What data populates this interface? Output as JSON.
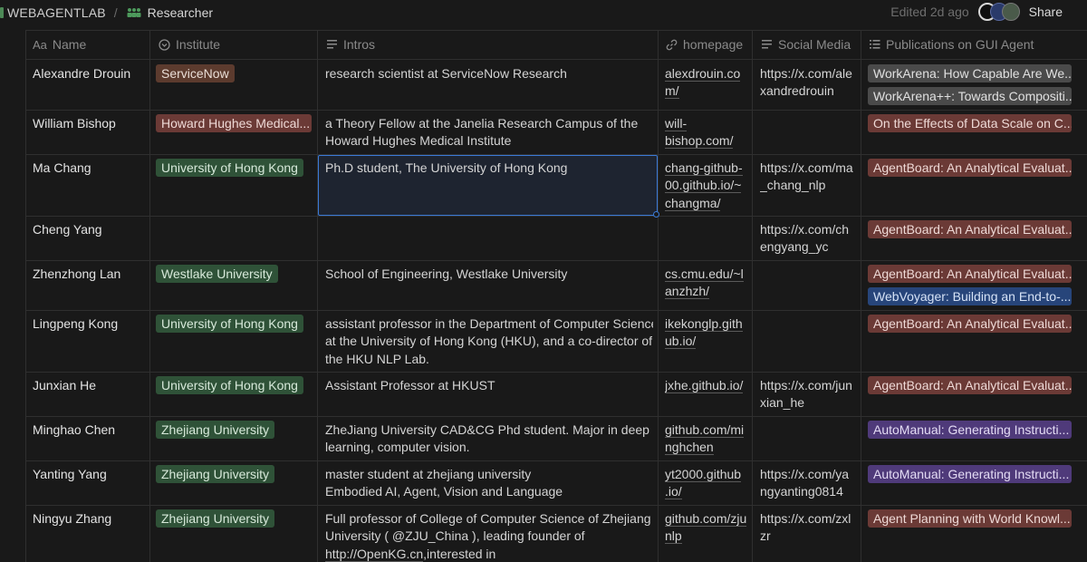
{
  "topbar": {
    "workspace": "WEBAGENTLAB",
    "separator": "/",
    "page_title": "Researcher",
    "edited": "Edited 2d ago",
    "share": "Share"
  },
  "columns": {
    "name": "Name",
    "name_icon": "Aa",
    "institute": "Institute",
    "intros": "Intros",
    "homepage": "homepage",
    "social": "Social Media",
    "publications": "Publications on GUI Agent"
  },
  "colors": {
    "brown": "#5c3b2e",
    "green": "#2f5238",
    "pink": "#6b3a36",
    "purple": "#4f3a7a",
    "blue": "#27457a",
    "gray": "#4a4a4a",
    "selection": "#3b7ad6"
  },
  "rows": [
    {
      "name": "Alexandre Drouin",
      "institute": "ServiceNow",
      "intro": [
        "research scientist at ServiceNow Research"
      ],
      "homepage": [
        "alexdrouin.co",
        "m/"
      ],
      "social": [
        "https://x.com/ale",
        "xandredrouin"
      ],
      "pubs": [
        "WorkArena: How Capable Are We...",
        "WorkArena++: Towards Compositi..."
      ]
    },
    {
      "name": "William Bishop",
      "institute": "Howard Hughes Medical...",
      "intro": [
        "a Theory Fellow at the Janelia Research Campus of the",
        "Howard Hughes Medical Institute"
      ],
      "homepage": [
        "will-",
        "bishop.com/"
      ],
      "social": [],
      "pubs": [
        "On the Effects of Data Scale on C..."
      ]
    },
    {
      "name": "Ma Chang",
      "institute": "University of Hong Kong",
      "intro": [
        "Ph.D student, The University of Hong Kong"
      ],
      "homepage": [
        "chang-github-",
        "00.github.io/~",
        "changma/"
      ],
      "social": [
        "https://x.com/ma",
        "_chang_nlp"
      ],
      "pubs": [
        "AgentBoard: An Analytical Evaluat..."
      ]
    },
    {
      "name": "Cheng Yang",
      "institute": "",
      "intro": [],
      "homepage": [],
      "social": [
        "https://x.com/ch",
        "engyang_yc"
      ],
      "pubs": [
        "AgentBoard: An Analytical Evaluat..."
      ]
    },
    {
      "name": "Zhenzhong Lan",
      "institute": "Westlake University",
      "intro": [
        "School of Engineering, Westlake University"
      ],
      "homepage": [
        "cs.cmu.edu/~l",
        "anzhzh/"
      ],
      "social": [],
      "pubs": [
        "AgentBoard: An Analytical Evaluat...",
        "WebVoyager: Building an End-to-..."
      ]
    },
    {
      "name": "Lingpeng Kong",
      "institute": "University of Hong Kong",
      "intro": [
        "assistant professor in the Department of Computer Science",
        "at the University of Hong Kong (HKU), and a co-director of",
        "the HKU NLP Lab."
      ],
      "homepage": [
        "ikekonglp.gith",
        "ub.io/"
      ],
      "social": [],
      "pubs": [
        "AgentBoard: An Analytical Evaluat..."
      ]
    },
    {
      "name": "Junxian He",
      "institute": "University of Hong Kong",
      "intro": [
        "Assistant Professor at HKUST"
      ],
      "homepage": [
        "jxhe.github.io/"
      ],
      "social": [
        "https://x.com/jun",
        "xian_he"
      ],
      "pubs": [
        "AgentBoard: An Analytical Evaluat..."
      ]
    },
    {
      "name": "Minghao Chen",
      "institute": "Zhejiang University",
      "intro": [
        "ZheJiang University CAD&CG Phd student. Major in deep",
        "learning, computer vision."
      ],
      "homepage": [
        "github.com/mi",
        "nghchen"
      ],
      "social": [],
      "pubs": [
        "AutoManual: Generating Instructi..."
      ]
    },
    {
      "name": "Yanting Yang",
      "institute": "Zhejiang University",
      "intro": [
        "master student at zhejiang university",
        "Embodied AI, Agent, Vision and Language"
      ],
      "homepage": [
        "yt2000.github",
        ".io/"
      ],
      "social": [
        "https://x.com/ya",
        "ngyanting0814"
      ],
      "pubs": [
        "AutoManual: Generating Instructi..."
      ]
    },
    {
      "name": "Ningyu Zhang",
      "institute": "Zhejiang University",
      "intro": [
        "Full professor of College of Computer Science of Zhejiang",
        "University ( @ZJU_China ), leading founder of",
        "http://OpenKG.cn,interested in"
      ],
      "homepage": [
        "github.com/zju",
        "nlp"
      ],
      "social": [
        "https://x.com/zxl",
        "zr"
      ],
      "pubs": [
        "Agent Planning with World Knowl..."
      ]
    }
  ]
}
